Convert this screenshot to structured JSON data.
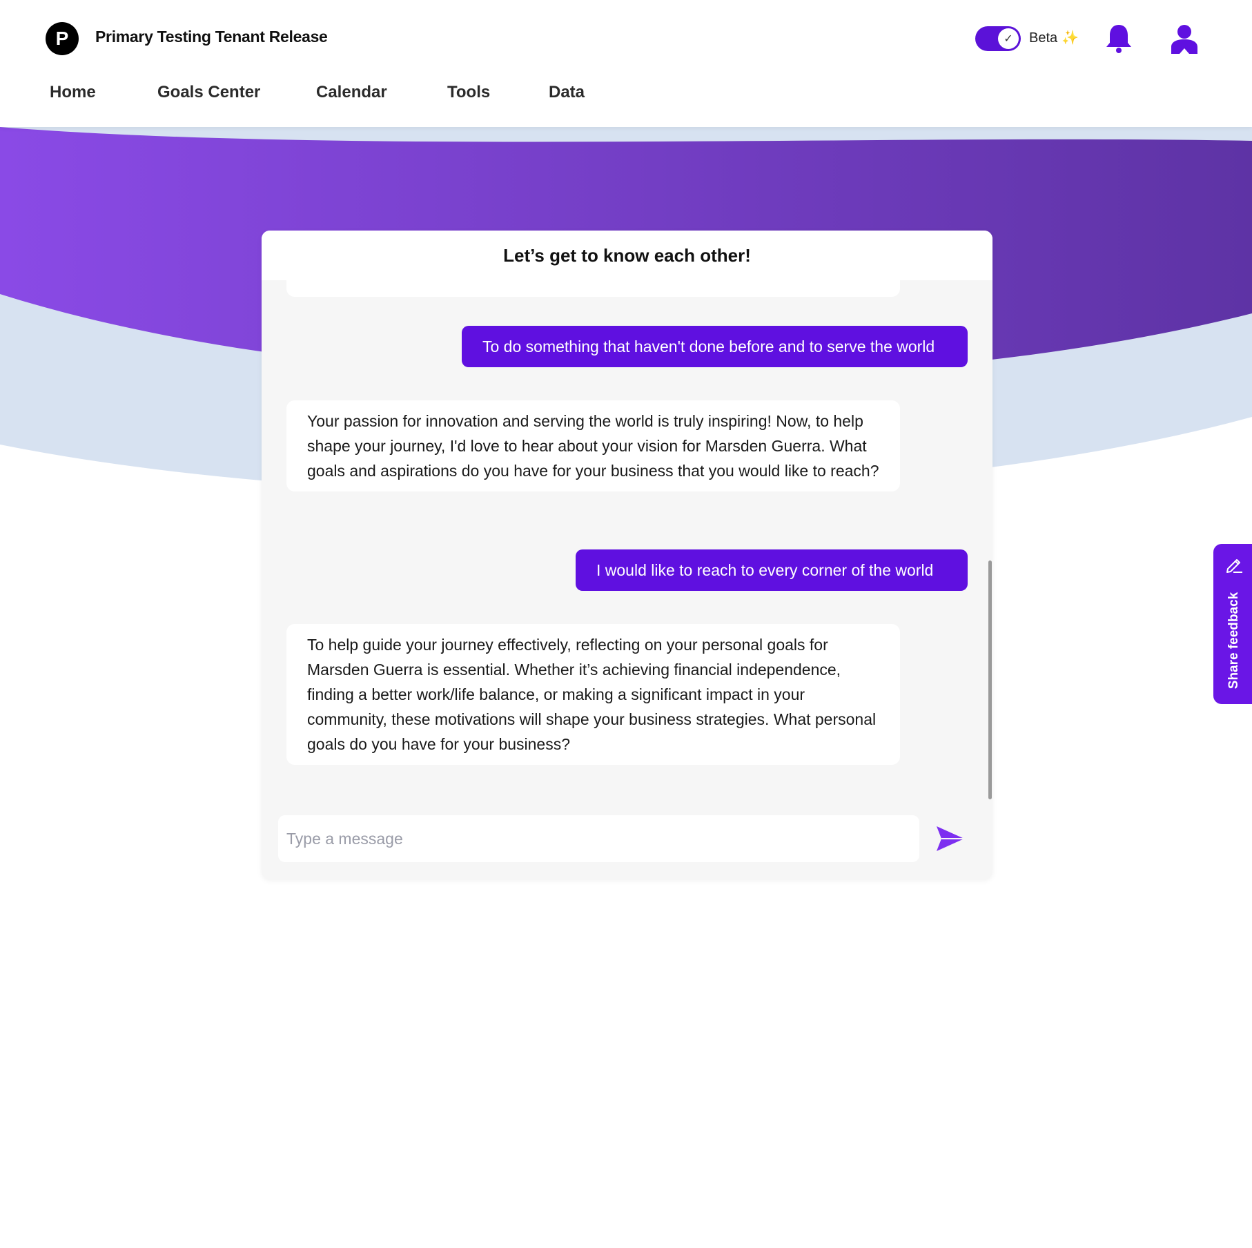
{
  "header": {
    "logo_letter": "P",
    "app_title": "Primary Testing Tenant Release",
    "beta_label": "Beta",
    "beta_spark": "✨",
    "beta_enabled": true,
    "bell_icon": "bell-icon",
    "user_icon": "user-icon"
  },
  "nav": {
    "items": [
      "Home",
      "Goals Center",
      "Calendar",
      "Tools",
      "Data"
    ]
  },
  "colors": {
    "primary": "#5f10e0",
    "hero_gradient_start": "#8a4ae6",
    "hero_gradient_end": "#5e33a5",
    "hero_wave_light": "#d7e2f1",
    "card_bg": "#f6f6f6"
  },
  "chat": {
    "title": "Let’s get to know each other!",
    "messages": [
      {
        "sender": "user",
        "text": "To do something that haven't done before and to serve the world"
      },
      {
        "sender": "bot",
        "text": "Your passion for innovation and serving the world is truly inspiring! Now, to help shape your journey, I'd love to hear about your vision for Marsden Guerra. What goals and aspirations do you have for your business that you would like to reach?"
      },
      {
        "sender": "user",
        "text": "I would like to reach to every corner of the world"
      },
      {
        "sender": "bot",
        "text": "To help guide your journey effectively, reflecting on your personal goals for Marsden Guerra is essential. Whether it’s achieving financial independence, finding a better work/life balance, or making a significant impact in your community, these motivations will shape your business strategies. What personal goals do you have for your business?"
      }
    ],
    "input": {
      "placeholder": "Type a message",
      "value": ""
    },
    "send_icon": "send-icon"
  },
  "feedback": {
    "label": "Share feedback",
    "icon": "pencil-icon"
  }
}
